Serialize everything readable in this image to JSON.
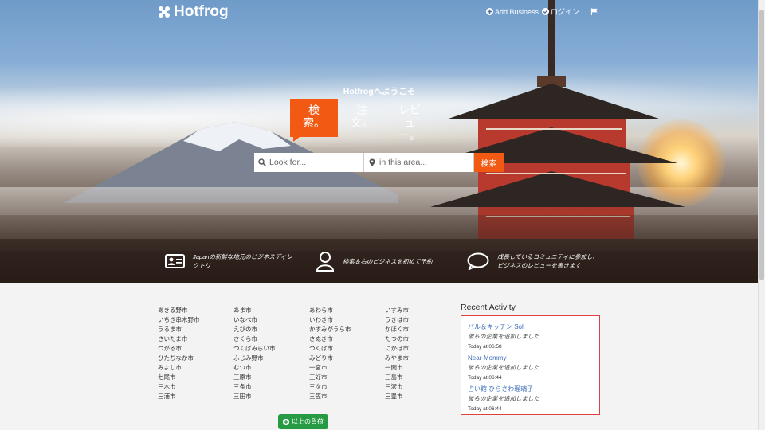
{
  "header": {
    "logo_text": "Hotfrog",
    "add_business": "Add Business",
    "login": "ログイン"
  },
  "hero": {
    "welcome": "Hotfrogへようこそ",
    "tabs": [
      {
        "label": "検索。",
        "active": true
      },
      {
        "label": "注文。",
        "active": false
      },
      {
        "label": "レビュー。",
        "active": false
      }
    ],
    "search": {
      "what_placeholder": "Look for...",
      "where_placeholder": "in this area...",
      "button": "検索"
    },
    "features": [
      {
        "icon": "id-card-icon",
        "text": "Japanの新鮮な地元のビジネスディレクトリ"
      },
      {
        "icon": "user-icon",
        "text": "検索＆右のビジネスを初めて予約"
      },
      {
        "icon": "chat-bubble-icon",
        "text": "成長しているコミュニティに参加し、ビジネスのレビューを書きます"
      }
    ]
  },
  "cities": [
    [
      "あきる野市",
      "いちき串木野市",
      "うるま市",
      "さいたま市",
      "つがる市",
      "ひたちなか市",
      "みよし市",
      "七尾市",
      "三木市",
      "三浦市"
    ],
    [
      "あま市",
      "いなべ市",
      "えびの市",
      "さくら市",
      "つくばみらい市",
      "ふじみ野市",
      "むつ市",
      "三原市",
      "三条市",
      "三田市"
    ],
    [
      "あわら市",
      "いわき市",
      "かすみがうら市",
      "さぬき市",
      "つくば市",
      "みどり市",
      "一宮市",
      "三好市",
      "三次市",
      "三笠市"
    ],
    [
      "いすみ市",
      "うきは市",
      "かほく市",
      "たつの市",
      "にかほ市",
      "みやま市",
      "一関市",
      "三島市",
      "三沢市",
      "三豊市"
    ]
  ],
  "more_button": "以上の負荷",
  "recent_activity": {
    "title": "Recent Activity",
    "items": [
      {
        "name": "バル＆キッチン Sol",
        "text": "彼らの企業を追加しました",
        "time": "Today at 06:58"
      },
      {
        "name": "Near-Mommy",
        "text": "彼らの企業を追加しました",
        "time": "Today at 06:44"
      },
      {
        "name": "占い館 ひらさわ瑠璃子",
        "text": "彼らの企業を追加しました",
        "time": "Today at 06:44"
      }
    ]
  },
  "colors": {
    "accent": "#f25a13",
    "green": "#279a44",
    "link": "#3d6fb8",
    "box_border": "#e04040"
  }
}
